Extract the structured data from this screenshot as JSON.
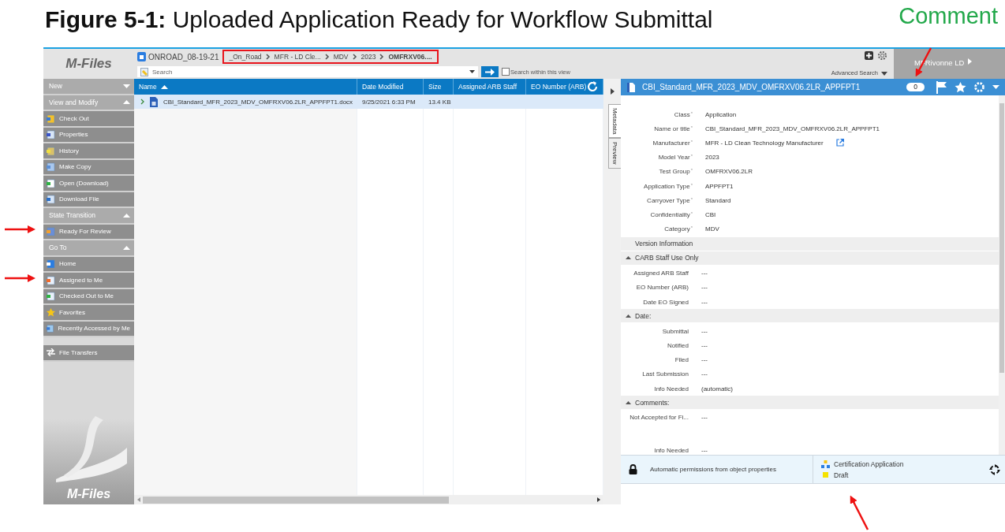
{
  "figure": {
    "caption": "**Figure 5-1:** Uploaded Application Ready for Workflow Submittal",
    "comment_label": "Comment"
  },
  "logo": {
    "top": "M-Files",
    "bottom": "M-Files"
  },
  "breadcrumb": {
    "vault": "ONROAD_08-19-21",
    "items": [
      {
        "label": "_On_Road",
        "current": false
      },
      {
        "label": "MFR - LD Cle...",
        "current": false
      },
      {
        "label": "MDV",
        "current": false
      },
      {
        "label": "2023",
        "current": false
      },
      {
        "label": "OMFRXV06....",
        "current": true
      }
    ]
  },
  "search": {
    "placeholder": "Search",
    "within_view": {
      "label": "Search within this view",
      "checked": false
    },
    "advanced": "Advanced Search"
  },
  "user": "MFRivonne LD",
  "sidebar": [
    {
      "title": "New",
      "expanded": false
    },
    {
      "title": "View and Modify",
      "expanded": true,
      "items": [
        {
          "label": "Check Out"
        },
        {
          "label": "Properties"
        },
        {
          "label": "History"
        },
        {
          "label": "Make Copy"
        },
        {
          "label": "Open (Download)"
        },
        {
          "label": "Download File"
        }
      ]
    },
    {
      "title": "State Transition",
      "expanded": true,
      "items": [
        {
          "label": "Ready For Review"
        }
      ]
    },
    {
      "title": "Go To",
      "expanded": true,
      "items": [
        {
          "label": "Home"
        },
        {
          "label": "Assigned to Me"
        },
        {
          "label": "Checked Out to Me"
        },
        {
          "label": "Favorites"
        },
        {
          "label": "Recently Accessed by Me"
        }
      ]
    }
  ],
  "file_transfers": "File Transfers",
  "list": {
    "columns": [
      {
        "label": "Name",
        "sorted": true
      },
      {
        "label": "Date Modified",
        "sorted": false
      },
      {
        "label": "Size",
        "sorted": false
      },
      {
        "label": "Assigned ARB Staff",
        "sorted": false
      },
      {
        "label": "EO Number (ARB)",
        "sorted": false
      }
    ],
    "rows": [
      {
        "cells": [
          "CBI_Standard_MFR_2023_MDV_OMFRXV06.2LR_APPFPT1.docx",
          "9/25/2021 6:33 PM",
          "13.4 KB",
          "",
          ""
        ],
        "selected": true
      }
    ]
  },
  "details": {
    "title": "CBI_Standard_MFR_2023_MDV_OMFRXV06.2LR_APPFPT1",
    "comment_count": "0",
    "tabs": [
      {
        "label": "Metadata",
        "selected": true
      },
      {
        "label": "Preview",
        "selected": false
      }
    ],
    "properties": [
      {
        "label": "Class",
        "required": "*",
        "value": "Application",
        "link": false
      },
      {
        "label": "Name or title",
        "required": "*",
        "value": "CBI_Standard_MFR_2023_MDV_OMFRXV06.2LR_APPFPT1",
        "link": false
      },
      {
        "label": "Manufacturer",
        "required": "*",
        "value": "MFR - LD Clean Technology Manufacturer",
        "link": true
      },
      {
        "label": "Model Year",
        "required": "*",
        "value": "2023",
        "link": false
      },
      {
        "label": "Test Group",
        "required": "*",
        "value": "OMFRXV06.2LR",
        "link": false
      },
      {
        "label": "Application Type",
        "required": "*",
        "value": "APPFPT1",
        "link": false
      },
      {
        "label": "Carryover Type",
        "required": "*",
        "value": "Standard",
        "link": false
      },
      {
        "label": "Confidentiality",
        "required": "*",
        "value": "CBI",
        "link": false
      },
      {
        "label": "Category",
        "required": "*",
        "value": "MDV",
        "link": false
      }
    ],
    "sections": [
      {
        "title": "Version Information",
        "kind": "plain",
        "expanded": false
      },
      {
        "title": "CARB Staff Use Only",
        "kind": "group",
        "expanded": true,
        "properties": [
          {
            "label": "Assigned ARB Staff",
            "value": "---"
          },
          {
            "label": "EO Number (ARB)",
            "value": "---"
          },
          {
            "label": "Date EO Signed",
            "value": "---"
          }
        ]
      },
      {
        "title": "Date:",
        "kind": "group",
        "expanded": true,
        "properties": [
          {
            "label": "Submittal",
            "value": "---"
          },
          {
            "label": "Notified",
            "value": "---"
          },
          {
            "label": "Filed",
            "value": "---"
          },
          {
            "label": "Last Submission",
            "value": "---"
          },
          {
            "label": "Info Needed",
            "value": "(automatic)"
          }
        ]
      },
      {
        "title": "Comments:",
        "kind": "group",
        "expanded": true,
        "properties": [
          {
            "label": "Not Accepted for Fi...",
            "value": "---",
            "tall": true
          },
          {
            "label": "Info Needed",
            "value": "---",
            "tall": false
          }
        ]
      }
    ],
    "permissions": "Automatic permissions from object properties",
    "workflow": "Certification Application",
    "state": "Draft"
  }
}
